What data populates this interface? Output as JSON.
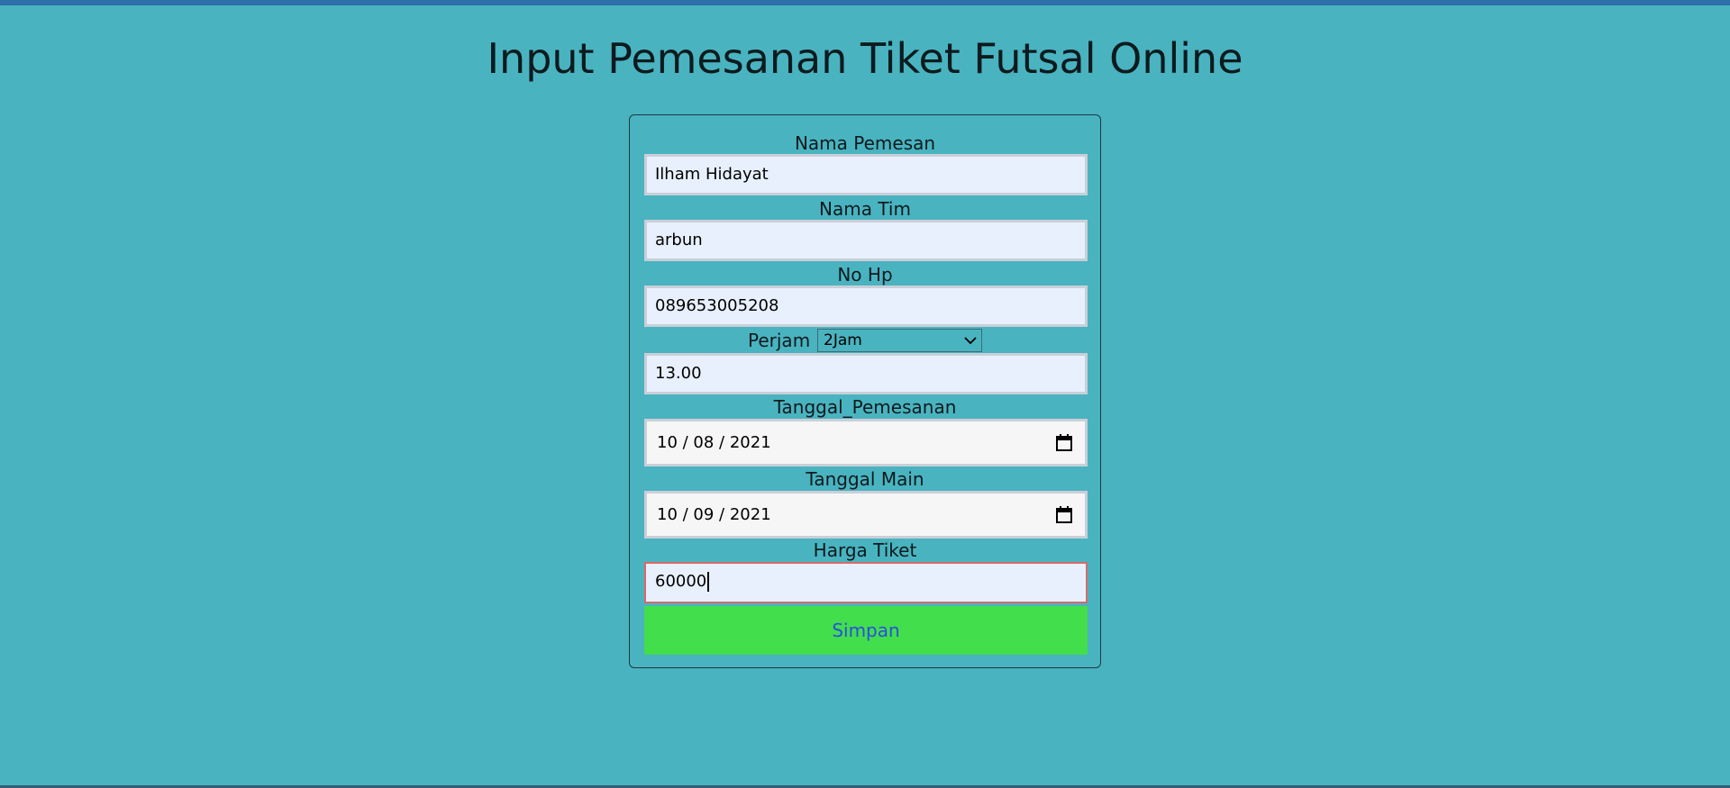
{
  "page": {
    "title": "Input Pemesanan Tiket Futsal Online"
  },
  "form": {
    "nama_pemesan": {
      "label": "Nama Pemesan",
      "value": "Ilham Hidayat"
    },
    "nama_tim": {
      "label": "Nama Tim",
      "value": "arbun"
    },
    "no_hp": {
      "label": "No Hp",
      "value": "089653005208"
    },
    "perjam": {
      "label": "Perjam",
      "selected": "2Jam",
      "value": "13.00"
    },
    "tanggal_pemesanan": {
      "label": "Tanggal_Pemesanan",
      "month": "10",
      "day": "08",
      "year": "2021"
    },
    "tanggal_main": {
      "label": "Tanggal Main",
      "month": "10",
      "day": "09",
      "year": "2021"
    },
    "harga_tiket": {
      "label": "Harga Tiket",
      "value": "60000"
    },
    "submit_label": "Simpan"
  },
  "icons": {
    "calendar": "calendar-icon",
    "dropdown": "chevron-down-icon"
  },
  "colors": {
    "background": "#4ab3c0",
    "input_bg": "#e8f0fe",
    "button_bg": "#42de4c",
    "button_text": "#2a4fe0"
  }
}
